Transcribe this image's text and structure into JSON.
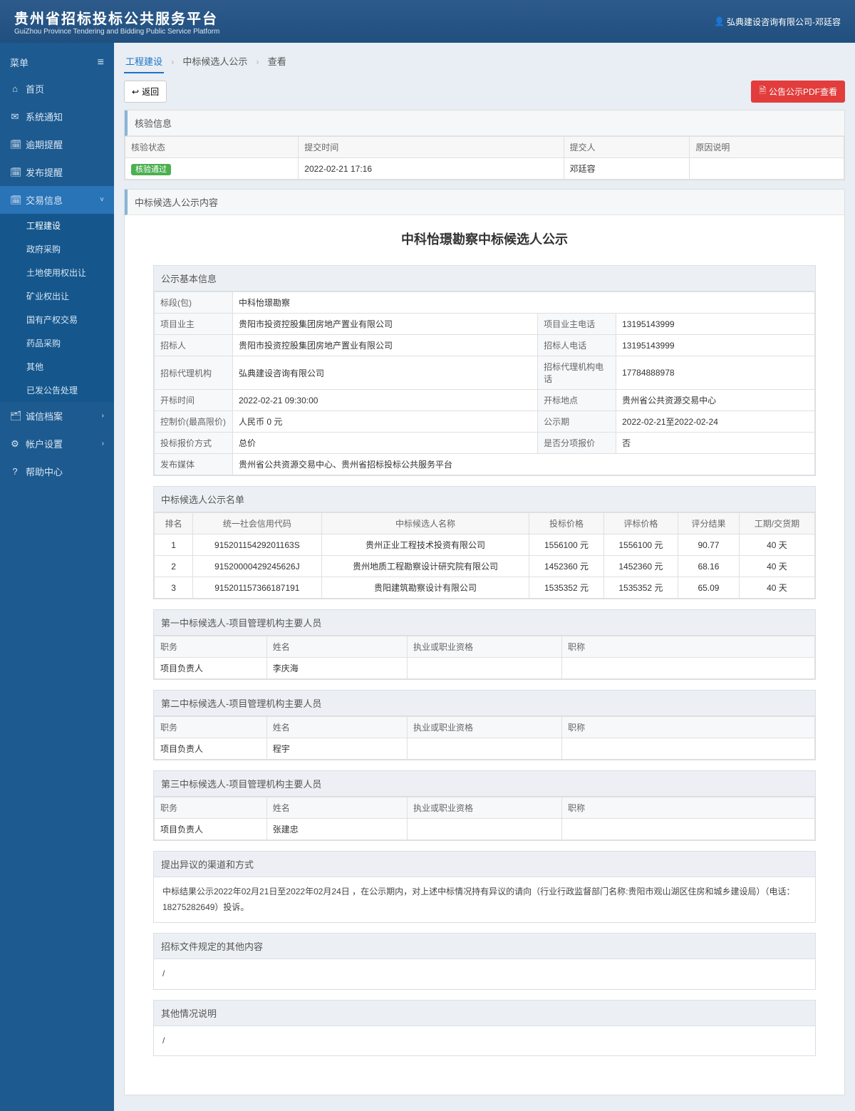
{
  "header": {
    "title_cn": "贵州省招标投标公共服务平台",
    "title_en": "GuiZhou Province Tendering and Bidding Public Service Platform",
    "user": "弘典建设咨询有限公司-邓廷容"
  },
  "sidebar": {
    "menu_label": "菜单",
    "items": [
      {
        "icon": "⌂",
        "label": "首页"
      },
      {
        "icon": "✉",
        "label": "系统通知"
      },
      {
        "icon": "🗓",
        "label": "逾期提醒"
      },
      {
        "icon": "🗓",
        "label": "发布提醒"
      },
      {
        "icon": "🗓",
        "label": "交易信息",
        "active": true,
        "chev": "˅"
      },
      {
        "icon": "🗂",
        "label": "诚信档案",
        "chev": "›"
      },
      {
        "icon": "⚙",
        "label": "帐户设置",
        "chev": "›"
      },
      {
        "icon": "?",
        "label": "帮助中心"
      }
    ],
    "subs": [
      "工程建设",
      "政府采购",
      "土地使用权出让",
      "矿业权出让",
      "国有产权交易",
      "药品采购",
      "其他",
      "已发公告处理"
    ]
  },
  "breadcrumb": [
    "工程建设",
    "中标候选人公示",
    "查看"
  ],
  "buttons": {
    "back": "返回",
    "pdf": "公告公示PDF查看"
  },
  "verify": {
    "title": "核验信息",
    "headers": [
      "核验状态",
      "提交时间",
      "提交人",
      "原因说明"
    ],
    "row": {
      "status": "核验通过",
      "time": "2022-02-21 17:16",
      "person": "邓廷容",
      "reason": ""
    }
  },
  "announce": {
    "section_title": "中标候选人公示内容",
    "title": "中科怡璟勘察中标候选人公示",
    "basic_title": "公示基本信息",
    "basic": {
      "bid_package_k": "标段(包)",
      "bid_package_v": "中科怡璟勘察",
      "owner_k": "项目业主",
      "owner_v": "贵阳市投资控股集团房地产置业有限公司",
      "owner_tel_k": "项目业主电话",
      "owner_tel_v": "13195143999",
      "tenderer_k": "招标人",
      "tenderer_v": "贵阳市投资控股集团房地产置业有限公司",
      "tenderer_tel_k": "招标人电话",
      "tenderer_tel_v": "13195143999",
      "agent_k": "招标代理机构",
      "agent_v": "弘典建设咨询有限公司",
      "agent_tel_k": "招标代理机构电话",
      "agent_tel_v": "17784888978",
      "open_time_k": "开标时间",
      "open_time_v": "2022-02-21 09:30:00",
      "open_place_k": "开标地点",
      "open_place_v": "贵州省公共资源交易中心",
      "limit_k": "控制价(最高限价)",
      "limit_v": "人民币 0 元",
      "period_k": "公示期",
      "period_v": "2022-02-21至2022-02-24",
      "quote_k": "投标报价方式",
      "quote_v": "总价",
      "split_k": "是否分项报价",
      "split_v": "否",
      "media_k": "发布媒体",
      "media_v": "贵州省公共资源交易中心、贵州省招标投标公共服务平台"
    },
    "list_title": "中标候选人公示名单",
    "list_headers": [
      "排名",
      "统一社会信用代码",
      "中标候选人名称",
      "投标价格",
      "评标价格",
      "评分结果",
      "工期/交货期"
    ],
    "list_rows": [
      {
        "rank": "1",
        "code": "91520115429201163S",
        "name": "贵州正业工程技术投资有限公司",
        "bid": "1556100 元",
        "eval": "1556100 元",
        "score": "90.77",
        "period": "40 天"
      },
      {
        "rank": "2",
        "code": "91520000429245626J",
        "name": "贵州地质工程勘察设计研究院有限公司",
        "bid": "1452360 元",
        "eval": "1452360 元",
        "score": "68.16",
        "period": "40 天"
      },
      {
        "rank": "3",
        "code": "915201157366187191",
        "name": "贵阳建筑勘察设计有限公司",
        "bid": "1535352 元",
        "eval": "1535352 元",
        "score": "65.09",
        "period": "40 天"
      }
    ],
    "cand_sections": [
      {
        "title": "第一中标候选人-项目管理机构主要人员",
        "leader": "李庆海"
      },
      {
        "title": "第二中标候选人-项目管理机构主要人员",
        "leader": "程宇"
      },
      {
        "title": "第三中标候选人-项目管理机构主要人员",
        "leader": "张建忠"
      }
    ],
    "cand_headers": {
      "duty": "职务",
      "name": "姓名",
      "qual": "执业或职业资格",
      "title": "职称",
      "leader_label": "项目负责人"
    },
    "dispute": {
      "title": "提出异议的渠道和方式",
      "text": "中标结果公示2022年02月21日至2022年02月24日 ，在公示期内，对上述中标情况持有异议的请向（行业行政监督部门名称:贵阳市观山湖区住房和城乡建设局）（电话：18275282649）投诉。"
    },
    "other_doc": {
      "title": "招标文件规定的其他内容",
      "text": "/"
    },
    "other_note": {
      "title": "其他情况说明",
      "text": "/"
    }
  }
}
